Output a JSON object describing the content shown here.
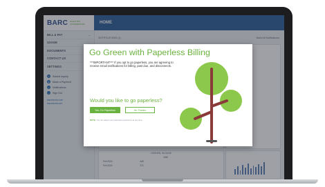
{
  "brand": {
    "logo_text": "BARC",
    "logo_tagline": "ELECTRIC COOPERATIVE"
  },
  "sidebar": {
    "nav": [
      {
        "label": "BILL & PAY"
      },
      {
        "label": "USAGE"
      },
      {
        "label": "DOCUMENTS"
      },
      {
        "label": "CONTACT US"
      },
      {
        "label": "SETTINGS"
      }
    ],
    "quick": [
      {
        "label": "Submit Inquiry"
      },
      {
        "label": "Make a Payment"
      },
      {
        "label": "Notifications"
      },
      {
        "label": "Sign Out"
      }
    ],
    "links": [
      {
        "label": "barcelectric.com"
      },
      {
        "label": "barcelectric.net"
      }
    ]
  },
  "header": {
    "title": "HOME"
  },
  "notifications": {
    "label": "NOTIFICATIONS (1)",
    "mark_all": "Mark All Notifications"
  },
  "background": {
    "location": "GOSHEN, VA 24439",
    "row_header": "kWh",
    "rows": [
      {
        "period": "Feb 2024",
        "value": "449"
      },
      {
        "period": "Feb 2024",
        "value": "371"
      }
    ]
  },
  "modal": {
    "title": "Go Green with Paperless Billing",
    "body": "***IMPORTANT*** If you opt to go paperless, you are agreeing to receive email notifications for billing, past due, and disconnects.",
    "question": "Would you like to go paperless?",
    "yes_label": "Yes, Go Paperless",
    "no_label": "No Thanks",
    "note_prefix": "NOTE:",
    "note_text": "You can adjust your paperless preference at any time."
  },
  "colors": {
    "accent_green": "#6ab23f",
    "header_blue": "#2b5d9a",
    "tree_green": "#8cc84b",
    "trunk": "#8b3a3a"
  }
}
